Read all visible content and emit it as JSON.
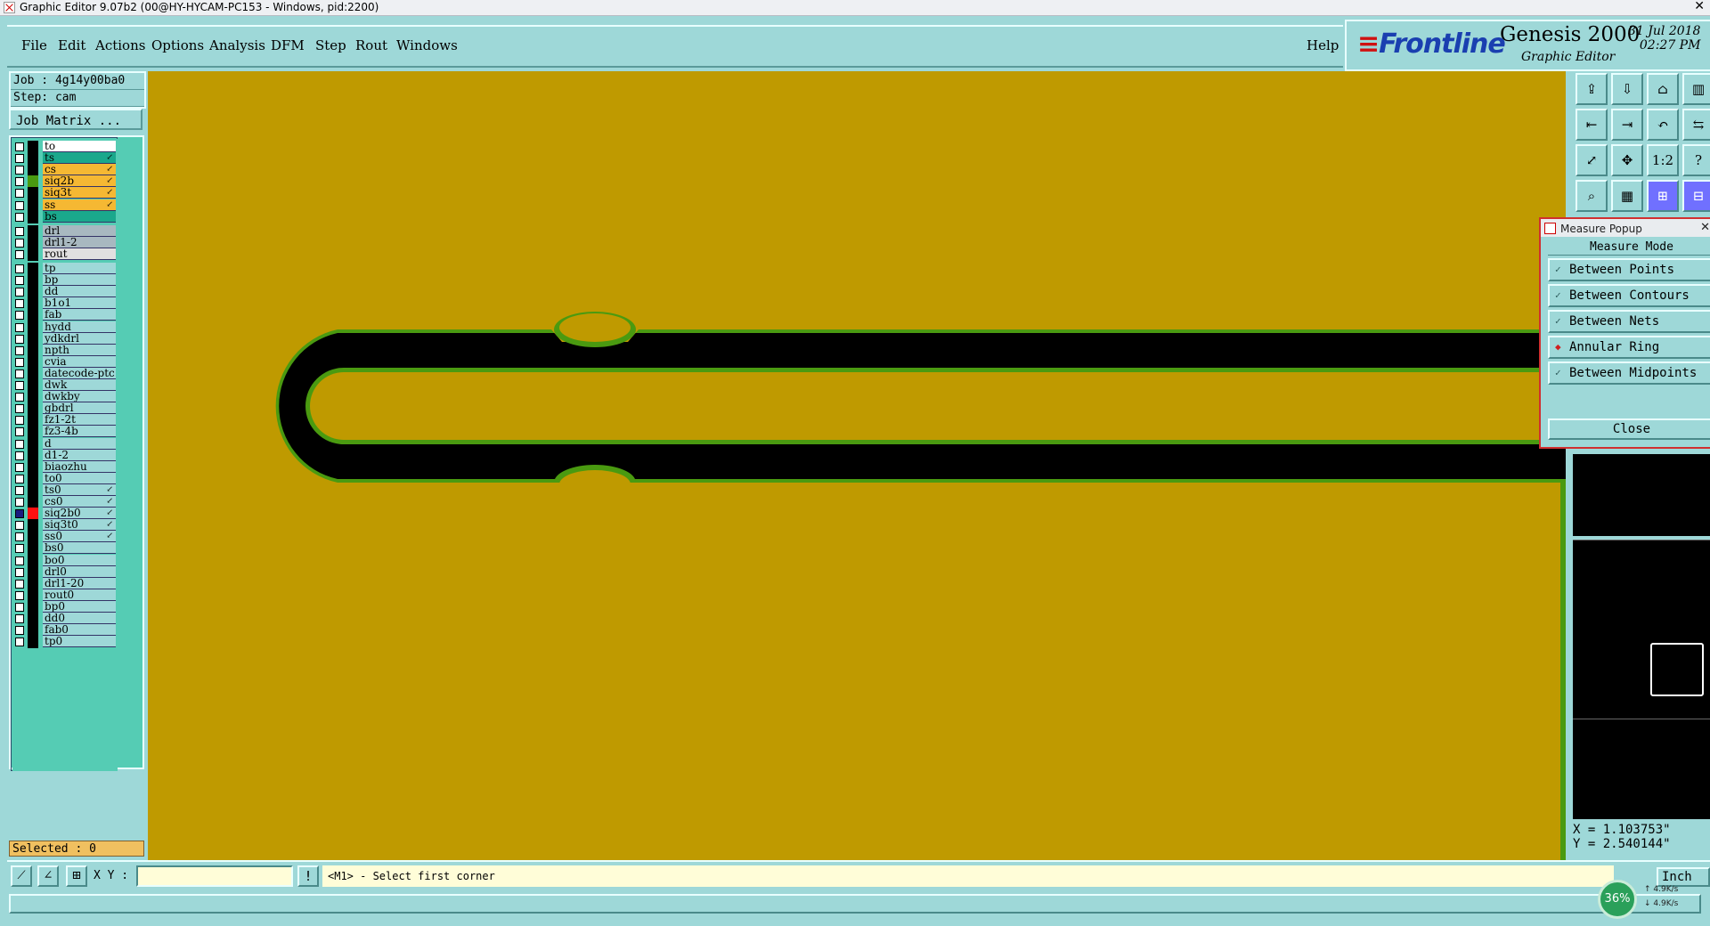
{
  "window": {
    "title": "Graphic Editor 9.07b2 (00@HY-HYCAM-PC153 - Windows, pid:2200)"
  },
  "menu": {
    "items": [
      "File",
      "Edit",
      "Actions",
      "Options",
      "Analysis",
      "DFM",
      "Step",
      "Rout",
      "Windows"
    ],
    "help": "Help"
  },
  "logo": {
    "brand": "Frontline",
    "product": "Genesis 2000",
    "subtitle": "Graphic Editor",
    "date": "31 Jul 2018",
    "time": "02:27 PM"
  },
  "job": {
    "job": "Job : 4g14y00ba0",
    "step": "Step: cam",
    "matrix_button": "Job Matrix ..."
  },
  "layers": {
    "group1": [
      {
        "name": "to",
        "color": "#ffffff",
        "arrow": ""
      },
      {
        "name": "ts",
        "color": "#1aa88c",
        "arrow": "↙"
      },
      {
        "name": "cs",
        "color": "#f5b833",
        "arrow": "↙"
      },
      {
        "name": "siq2b",
        "color": "#f5b833",
        "arrow": "↙"
      },
      {
        "name": "siq3t",
        "color": "#f5b833",
        "arrow": "↙"
      },
      {
        "name": "ss",
        "color": "#f5b833",
        "arrow": "↙"
      },
      {
        "name": "bs",
        "color": "#1aa88c",
        "arrow": ""
      }
    ],
    "group2": [
      {
        "name": "drl",
        "color": "#a8b8c0",
        "arrow": ""
      },
      {
        "name": "drl1-2",
        "color": "#a8b8c0",
        "arrow": ""
      },
      {
        "name": "rout",
        "color": "#e0e0e0",
        "arrow": ""
      }
    ],
    "group3": [
      "tp",
      "bp",
      "dd",
      "b1o1",
      "fab",
      "hydd",
      "ydkdrl",
      "npth",
      "cvia",
      "datecode-ptc",
      "dwk",
      "dwkby",
      "gbdrl",
      "fz1-2t",
      "fz3-4b",
      "d",
      "d1-2",
      "biaozhu",
      "to0",
      "ts0",
      "cs0",
      "siq2b0",
      "siq3t0",
      "ss0",
      "bs0",
      "bo0",
      "drl0",
      "drl1-20",
      "rout0",
      "bp0",
      "dd0",
      "fab0",
      "tp0"
    ],
    "arrowed": [
      "ts0",
      "cs0",
      "siq2b0",
      "siq3t0",
      "ss0"
    ],
    "active": "siq2b0",
    "active_color": "#ff1010",
    "green_square": "siq2b"
  },
  "selected": "Selected : 0",
  "canvas": {
    "bg": "#bf9a00",
    "trace": "#000000",
    "outline": "#4a9a10"
  },
  "toolbar": {
    "icons": [
      "open-icon",
      "save-icon",
      "home-icon",
      "window-icon",
      "prev-icon",
      "next-icon",
      "undo-icon",
      "route-icon",
      "fit-icon",
      "center-icon",
      "scale-icon",
      "help-icon",
      "magnify-icon",
      "grid-icon",
      "layer-a-icon",
      "layer-b-icon"
    ],
    "scale_label": "1:2",
    "help_label": "?"
  },
  "measure": {
    "title": "Measure Popup",
    "mode_label": "Measure Mode",
    "options": [
      "Between Points",
      "Between Contours",
      "Between Nets",
      "Annular Ring",
      "Between Midpoints"
    ],
    "selected": "Annular Ring",
    "close": "Close"
  },
  "coords": {
    "x": "X = 1.103753\"",
    "y": "Y = 2.540144\""
  },
  "bottom": {
    "xy_label": "X Y :",
    "xy_value": "",
    "prompt": "<M1> - Select first corner",
    "units": "Inch",
    "exclaim": "!"
  },
  "network": {
    "percent": "36%",
    "up": "4.9K/s",
    "down": "4.9K/s"
  }
}
